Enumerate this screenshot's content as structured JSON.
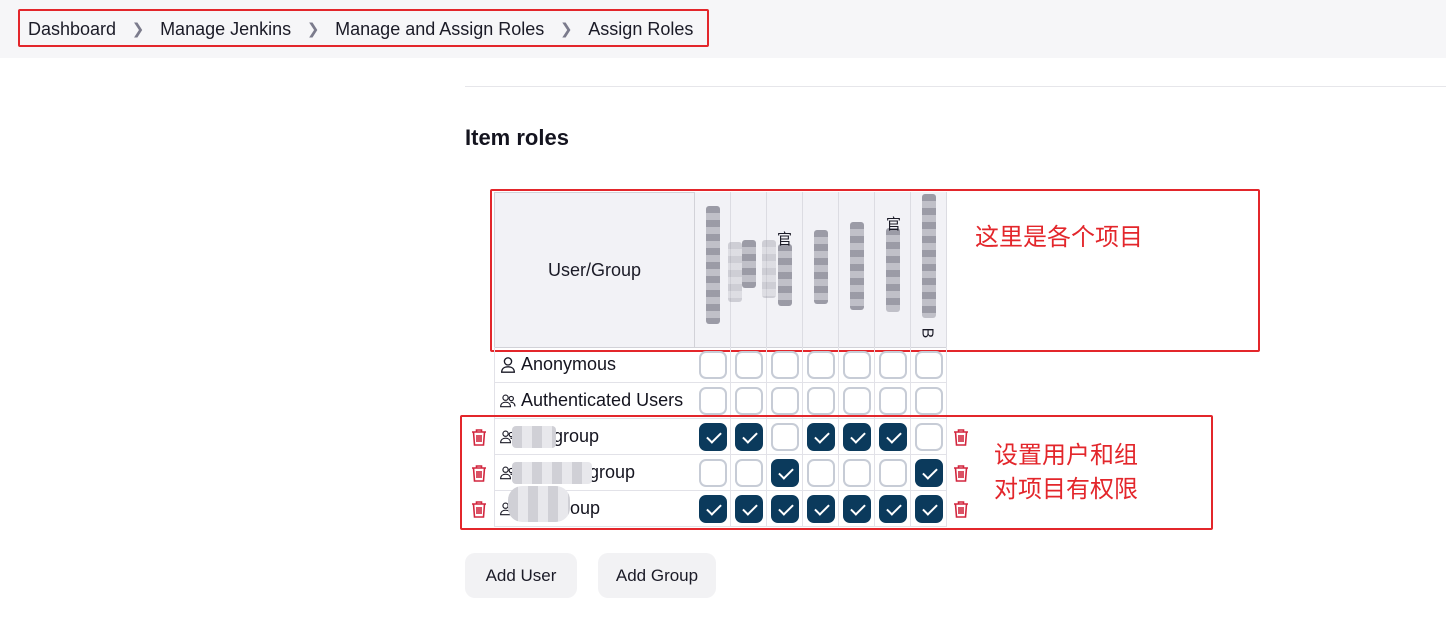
{
  "breadcrumb": {
    "items": [
      {
        "label": "Dashboard"
      },
      {
        "label": "Manage Jenkins"
      },
      {
        "label": "Manage and Assign Roles"
      },
      {
        "label": "Assign Roles"
      }
    ]
  },
  "section": {
    "title": "Item roles"
  },
  "table": {
    "header_label": "User/Group",
    "row_labels": {
      "anonymous": "Anonymous",
      "authenticated": "Authenticated Users",
      "group1": "group",
      "group2": "group",
      "group3": "group"
    },
    "rows": [
      {
        "checked": [
          false,
          false,
          false,
          false,
          false,
          false,
          false
        ]
      },
      {
        "checked": [
          false,
          false,
          false,
          false,
          false,
          false,
          false
        ]
      },
      {
        "checked": [
          true,
          true,
          false,
          true,
          true,
          true,
          false
        ]
      },
      {
        "checked": [
          false,
          false,
          true,
          false,
          false,
          false,
          true
        ]
      },
      {
        "checked": [
          true,
          true,
          true,
          true,
          true,
          true,
          true
        ]
      }
    ],
    "role_header_fragments": {
      "col3": "官",
      "col6": "官",
      "col7": "B"
    }
  },
  "annotations": {
    "header_note": "这里是各个项目",
    "rows_note_line1": "设置用户和组",
    "rows_note_line2": "对项目有权限"
  },
  "buttons": {
    "add_user": "Add User",
    "add_group": "Add Group"
  },
  "colors": {
    "checkbox_checked": "#0b3a5c",
    "annotation_red": "#e3262b",
    "delete_icon_red": "#d2263e"
  },
  "icons": {
    "user": "user-icon",
    "group": "group-icon",
    "delete": "trash-icon",
    "separator": "chevron-right-icon"
  }
}
